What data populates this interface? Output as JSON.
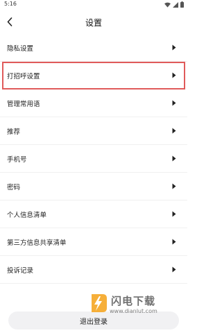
{
  "status_bar": {
    "time": "5:16"
  },
  "header": {
    "title": "设置"
  },
  "settings": {
    "items": [
      {
        "label": "隐私设置"
      },
      {
        "label": "打招呼设置"
      },
      {
        "label": "管理常用语"
      },
      {
        "label": "推荐"
      },
      {
        "label": "手机号"
      },
      {
        "label": "密码"
      },
      {
        "label": "个人信息清单"
      },
      {
        "label": "第三方信息共享清单"
      },
      {
        "label": "投诉记录"
      }
    ]
  },
  "footer": {
    "logout_label": "退出登录"
  },
  "watermark": {
    "name": "闪电下载",
    "url": "www.dianlut.com"
  },
  "colors": {
    "highlight": "#e05a5a",
    "logout_bg": "#f1f1f3",
    "watermark_orange": "#f5a623"
  }
}
